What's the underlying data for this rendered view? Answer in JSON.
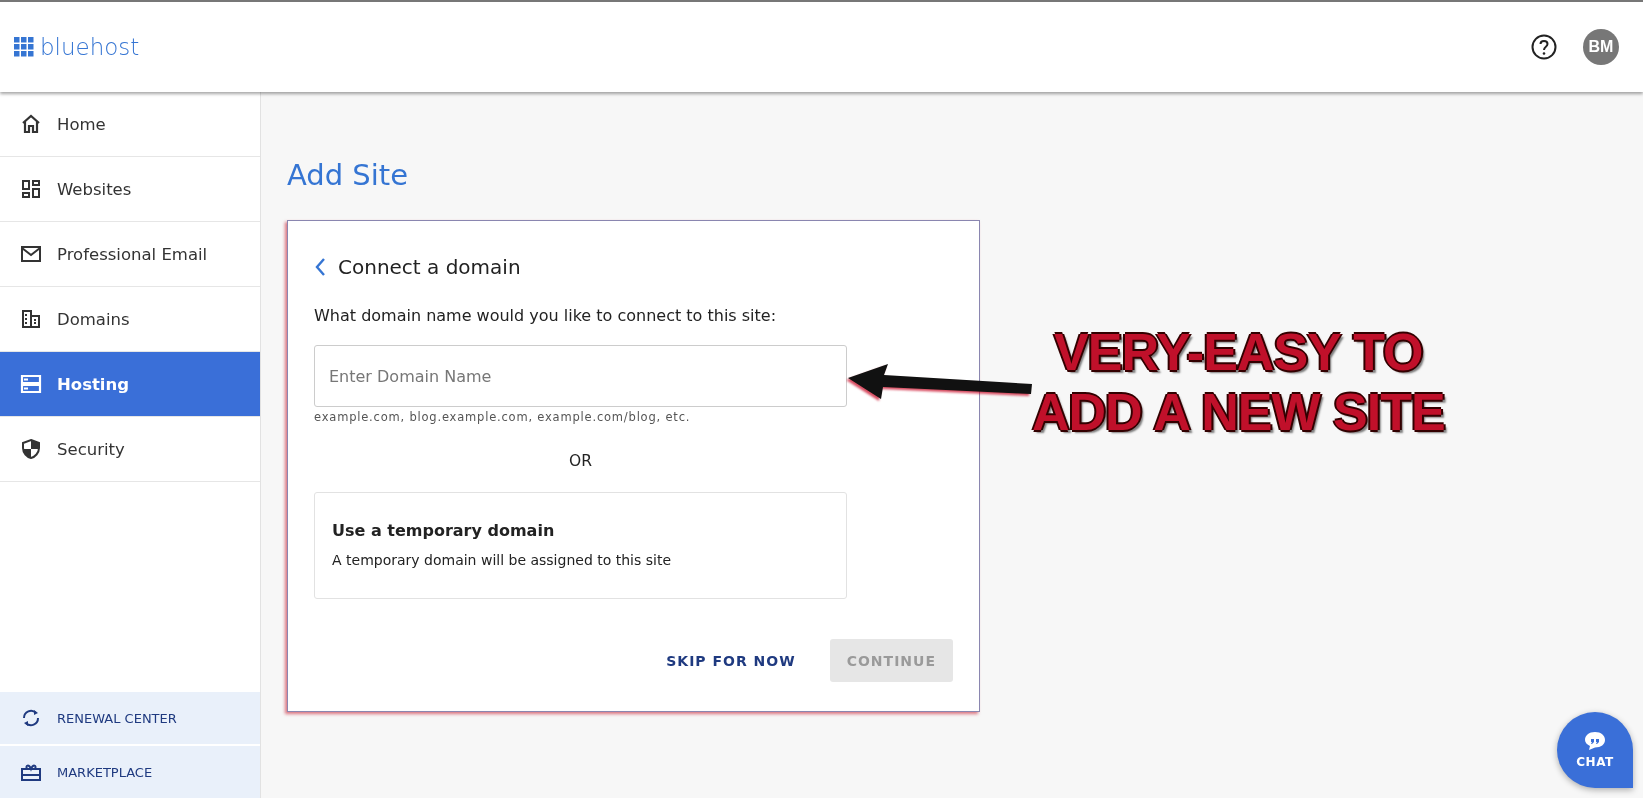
{
  "header": {
    "logo": "bluehost",
    "avatar": "BM"
  },
  "sidebar": {
    "items": [
      {
        "label": "Home",
        "selected": false
      },
      {
        "label": "Websites",
        "selected": false
      },
      {
        "label": "Professional Email",
        "selected": false
      },
      {
        "label": "Domains",
        "selected": false
      },
      {
        "label": "Hosting",
        "selected": true
      },
      {
        "label": "Security",
        "selected": false
      }
    ],
    "footer_items": [
      {
        "label": "RENEWAL CENTER"
      },
      {
        "label": "MARKETPLACE"
      }
    ]
  },
  "page_title": "Add Site",
  "card": {
    "title": "Connect a domain",
    "question": "What domain name would you like to connect to this site:",
    "domain_field": {
      "placeholder": "Enter Domain Name"
    },
    "hint": "example.com, blog.example.com, example.com/blog, etc.",
    "separator": "OR",
    "option": {
      "title": "Use a temporary domain",
      "description": "A temporary domain will be assigned to this site"
    },
    "buttons": [
      {
        "label": "SKIP FOR NOW",
        "kind": "link",
        "disabled": false
      },
      {
        "label": "CONTINUE",
        "kind": "primary",
        "disabled": true
      }
    ]
  },
  "annotation": {
    "lines": [
      "VERY-EASY TO",
      "ADD A NEW SITE"
    ]
  },
  "chat": {
    "label": "CHAT"
  }
}
